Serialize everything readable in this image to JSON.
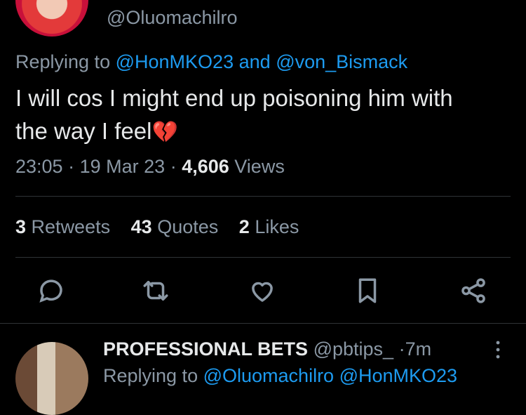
{
  "tweet": {
    "handle": "@Oluomachilro",
    "reply_prefix": "Replying to",
    "reply_mention_1": "@HonMKO23",
    "reply_and": "and",
    "reply_mention_2": "@von_Bismack",
    "text_line1": "I will cos I might end up poisoning him with",
    "text_line2": "the way I feel",
    "emoji": "💔",
    "time": "23:05",
    "date": "19 Mar 23",
    "views_count": "4,606",
    "views_label": "Views"
  },
  "stats": {
    "retweets_count": "3",
    "retweets_label": "Retweets",
    "quotes_count": "43",
    "quotes_label": "Quotes",
    "likes_count": "2",
    "likes_label": "Likes"
  },
  "actions": [
    "reply-icon",
    "retweet-icon",
    "like-icon",
    "bookmark-icon",
    "share-icon"
  ],
  "next_reply": {
    "name": "PROFESSIONAL BETS",
    "handle": "@pbtips_",
    "separator": "·",
    "age": "7m",
    "reply_prefix": "Replying to",
    "mention_1": "@Oluomachilro",
    "mention_2": "@HonMKO23"
  },
  "colors": {
    "background": "#000000",
    "text": "#e7e9ea",
    "muted": "#8b98a5",
    "link": "#1d9bf0",
    "divider": "#2f3336"
  }
}
